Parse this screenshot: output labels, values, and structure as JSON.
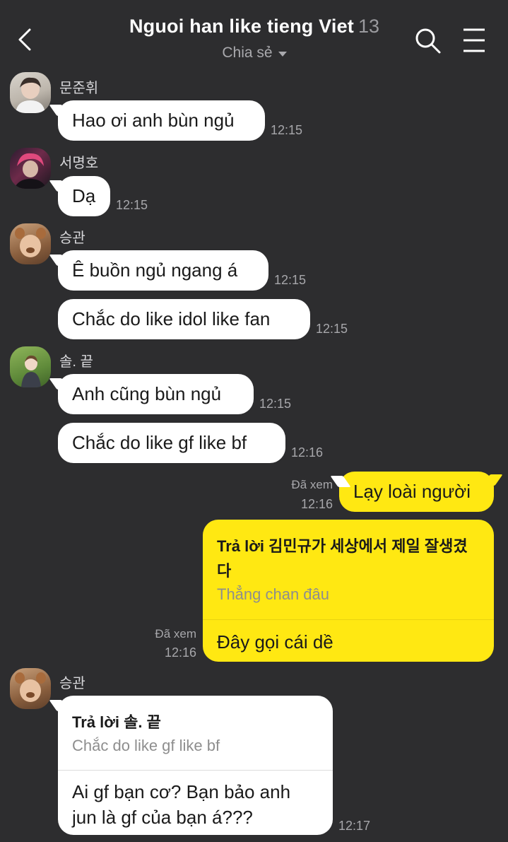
{
  "header": {
    "title": "Nguoi han like tieng Viet",
    "member_count": "13",
    "subtitle": "Chia sẻ"
  },
  "icons": {
    "back": "chevron-left-icon",
    "search": "search-icon",
    "menu": "hamburger-menu-icon",
    "caret": "caret-down-icon"
  },
  "colors": {
    "background": "#2d2d2f",
    "incoming_bubble": "#ffffff",
    "outgoing_bubble": "#ffe812"
  },
  "messages": {
    "m1": {
      "sender": "문준휘",
      "text": "Hao ơi anh bùn ngủ",
      "time": "12:15"
    },
    "m2": {
      "sender": "서명호",
      "text": "Dạ",
      "time": "12:15"
    },
    "m3": {
      "sender": "승관",
      "text": "Ê buồn ngủ ngang á",
      "time": "12:15"
    },
    "m4": {
      "text": "Chắc do like idol like fan",
      "time": "12:15"
    },
    "m5": {
      "sender": "솔. 끝",
      "text": "Anh cũng bùn ngủ",
      "time": "12:15"
    },
    "m6": {
      "text": "Chắc do like gf like bf",
      "time": "12:16"
    },
    "m7": {
      "read": "Đã xem",
      "time": "12:16",
      "text": "Lạy loài người"
    },
    "m8": {
      "read": "Đã xem",
      "time": "12:16",
      "reply_to": "Trả lời 김민규가 세상에서 제일 잘생겼다",
      "quote": "Thẳng chan đâu",
      "text": "Đây gọi cái dề"
    },
    "m9": {
      "sender": "승관",
      "time": "12:17",
      "reply_to": "Trả lời 솔. 끝",
      "quote": "Chắc do like gf like bf",
      "text_line1": "Ai gf bạn cơ? Bạn bảo anh",
      "text_line2": "jun là gf của bạn á???"
    }
  }
}
